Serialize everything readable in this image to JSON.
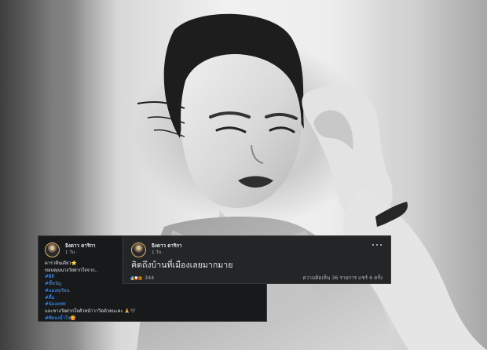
{
  "right_post": {
    "author": "อิงดาว ดาริกา",
    "time": "1 วัน · ",
    "content": "คิดถึงบ้านที่เมืองเลยมากมาย",
    "reaction_count": "344",
    "stats": "ความคิดเห็น 36 รายการ  แชร์ 6 ครั้ง",
    "reaction_icons": [
      "like-icon",
      "love-icon",
      "haha-icon"
    ]
  },
  "left_post": {
    "author": "อิงดาว ดาริกา",
    "time": "1 วัน · ",
    "lines": [
      {
        "text": "ดาราดินเดียว⭐",
        "kind": "text"
      },
      {
        "text": "ขอบคุณนางวัยฝากใจจาก..",
        "kind": "text"
      },
      {
        "text": "#ผีสี",
        "kind": "tag"
      },
      {
        "text": "#ขี้ขวัญ",
        "kind": "tag"
      },
      {
        "text": "#แมงทุเรียน",
        "kind": "tag"
      },
      {
        "text": "#ตื้ม",
        "kind": "tag"
      },
      {
        "text": "#น้องแพท",
        "kind": "tag"
      },
      {
        "text": "และขางวัยฝากใจตัวหน้าวาวิดด้วยนะคะ 🙏🖤",
        "kind": "text"
      },
      {
        "text": "#พี่ทองน้ำใจ🥰",
        "kind": "tag"
      }
    ]
  },
  "colors": {
    "card_dark": "#18191a",
    "card_mid": "#242526",
    "text": "#e4e6eb",
    "muted": "#b0b3b8",
    "hashtag": "#4aa3ff"
  }
}
